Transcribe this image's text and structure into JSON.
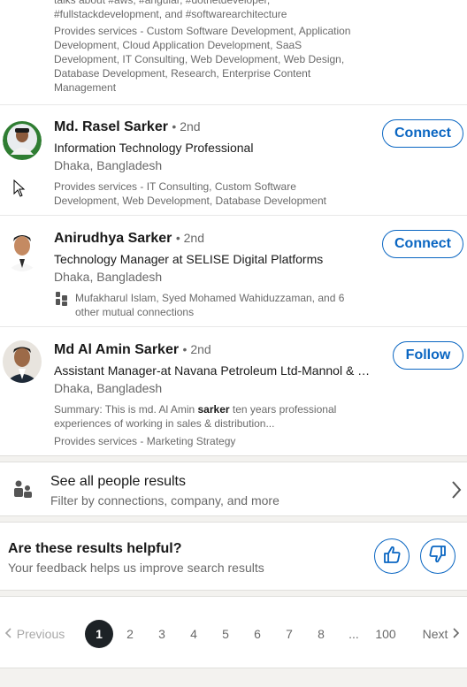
{
  "top_result": {
    "snippet_clip": "talks about #aws, #angular, #dotnetdeveloper, #fullstackdevelopment, and #softwarearchitecture",
    "services": "Provides services - Custom Software Development, Application Development, Cloud Application Development, SaaS Development, IT Consulting, Web Development, Web Design, Database Development, Research, Enterprise Content Management"
  },
  "people": [
    {
      "name": "Md. Rasel Sarker",
      "degree": "• 2nd",
      "headline": "Information Technology Professional",
      "location": "Dhaka, Bangladesh",
      "extra": "Provides services - IT Consulting, Custom Software Development, Web Development, Database Development",
      "action": "Connect"
    },
    {
      "name": "Anirudhya Sarker",
      "degree": "• 2nd",
      "headline": "Technology Manager at SELISE Digital Platforms",
      "location": "Dhaka, Bangladesh",
      "mutual_names": "Mufakharul Islam, Syed Mohamed Wahiduzzaman,",
      "mutual_rest": " and 6 other mutual connections",
      "action": "Connect"
    },
    {
      "name": "Md Al Amin Sarker",
      "degree": "• 2nd",
      "headline": "Assistant Manager-at Navana Petroleum Ltd-Mannol & P...",
      "location": "Dhaka, Bangladesh",
      "summary_pre": "Summary: This is md. Al Amin ",
      "summary_bold": "sarker",
      "summary_post": " ten years professional experiences of working in sales & distribution...",
      "services": "Provides services - Marketing Strategy",
      "action": "Follow"
    }
  ],
  "see_all": {
    "title": "See all people results",
    "subtitle": "Filter by connections, company, and more"
  },
  "feedback": {
    "title": "Are these results helpful?",
    "subtitle": "Your feedback helps us improve search results"
  },
  "pagination": {
    "previous": "Previous",
    "next": "Next",
    "pages": [
      "1",
      "2",
      "3",
      "4",
      "5",
      "6",
      "7",
      "8",
      "...",
      "100"
    ],
    "current": "1"
  },
  "colors": {
    "accent": "#0a66c2",
    "active_page": "#1d2226"
  }
}
